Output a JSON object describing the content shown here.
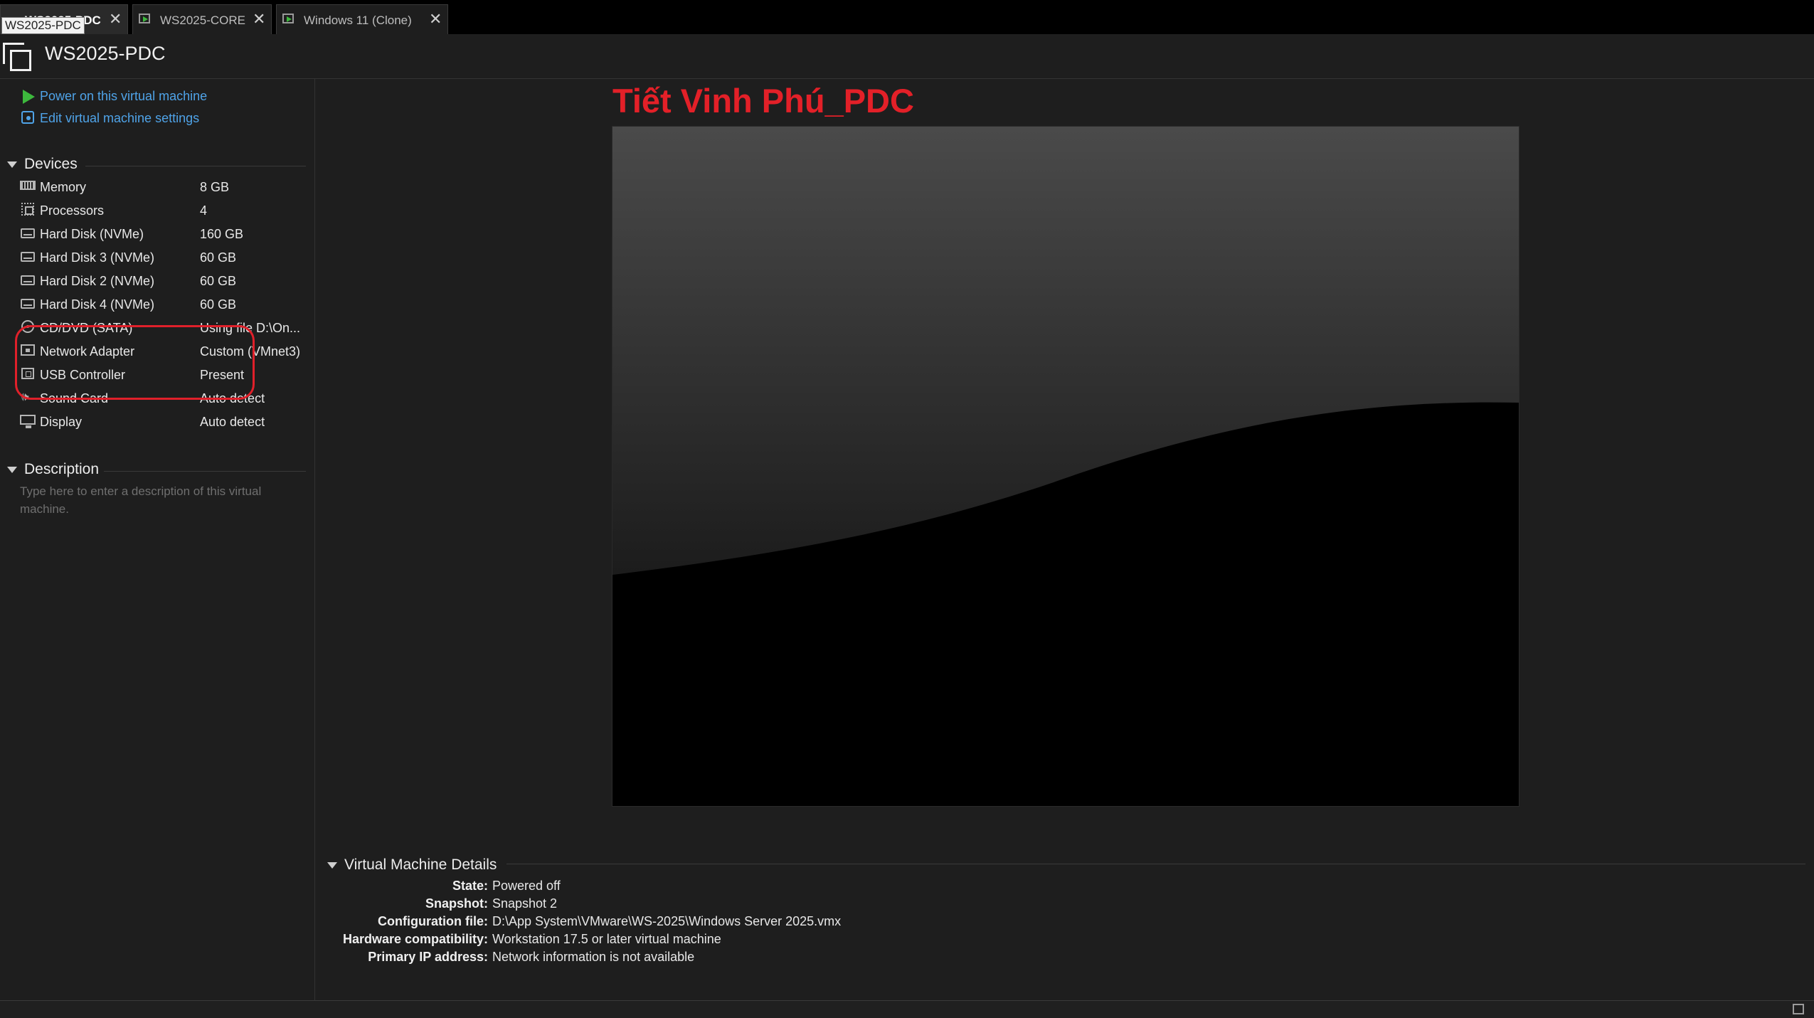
{
  "tabs": [
    {
      "label": "WS2025-PDC",
      "active": true
    },
    {
      "label": "WS2025-CORE",
      "active": false
    },
    {
      "label": "Windows 11 (Clone)",
      "active": false
    }
  ],
  "tooltip": "WS2025-PDC",
  "vm_title": "WS2025-PDC",
  "actions": {
    "power_on": "Power on this virtual machine",
    "edit_settings": "Edit virtual machine settings"
  },
  "devices": {
    "heading": "Devices",
    "items": [
      {
        "name": "Memory",
        "value": "8 GB",
        "icon": "memory-icon"
      },
      {
        "name": "Processors",
        "value": "4",
        "icon": "processor-icon"
      },
      {
        "name": "Hard Disk (NVMe)",
        "value": "160 GB",
        "icon": "hard-disk-icon"
      },
      {
        "name": "Hard Disk 3 (NVMe)",
        "value": "60 GB",
        "icon": "hard-disk-icon"
      },
      {
        "name": "Hard Disk 2 (NVMe)",
        "value": "60 GB",
        "icon": "hard-disk-icon"
      },
      {
        "name": "Hard Disk 4 (NVMe)",
        "value": "60 GB",
        "icon": "hard-disk-icon"
      },
      {
        "name": "CD/DVD (SATA)",
        "value": "Using file D:\\On...",
        "icon": "cd-dvd-icon"
      },
      {
        "name": "Network Adapter",
        "value": "Custom (VMnet3)",
        "icon": "network-adapter-icon"
      },
      {
        "name": "USB Controller",
        "value": "Present",
        "icon": "usb-controller-icon"
      },
      {
        "name": "Sound Card",
        "value": "Auto detect",
        "icon": "sound-card-icon"
      },
      {
        "name": "Display",
        "value": "Auto detect",
        "icon": "display-icon"
      }
    ]
  },
  "description": {
    "heading": "Description",
    "placeholder": "Type here to enter a description of this virtual machine."
  },
  "overlay_title": "Tiết Vinh Phú_PDC",
  "details": {
    "heading": "Virtual Machine Details",
    "rows": [
      {
        "key": "State:",
        "value": "Powered off"
      },
      {
        "key": "Snapshot:",
        "value": "Snapshot 2"
      },
      {
        "key": "Configuration file:",
        "value": "D:\\App System\\VMware\\WS-2025\\Windows Server 2025.vmx"
      },
      {
        "key": "Hardware compatibility:",
        "value": "Workstation 17.5 or later virtual machine"
      },
      {
        "key": "Primary IP address:",
        "value": "Network information is not available"
      }
    ]
  },
  "colors": {
    "accent_link": "#4fa3e8",
    "power_green": "#3db83d",
    "annotation_red": "#e0202a",
    "overlay_title_red": "#e32028",
    "background": "#1e1e1e"
  }
}
